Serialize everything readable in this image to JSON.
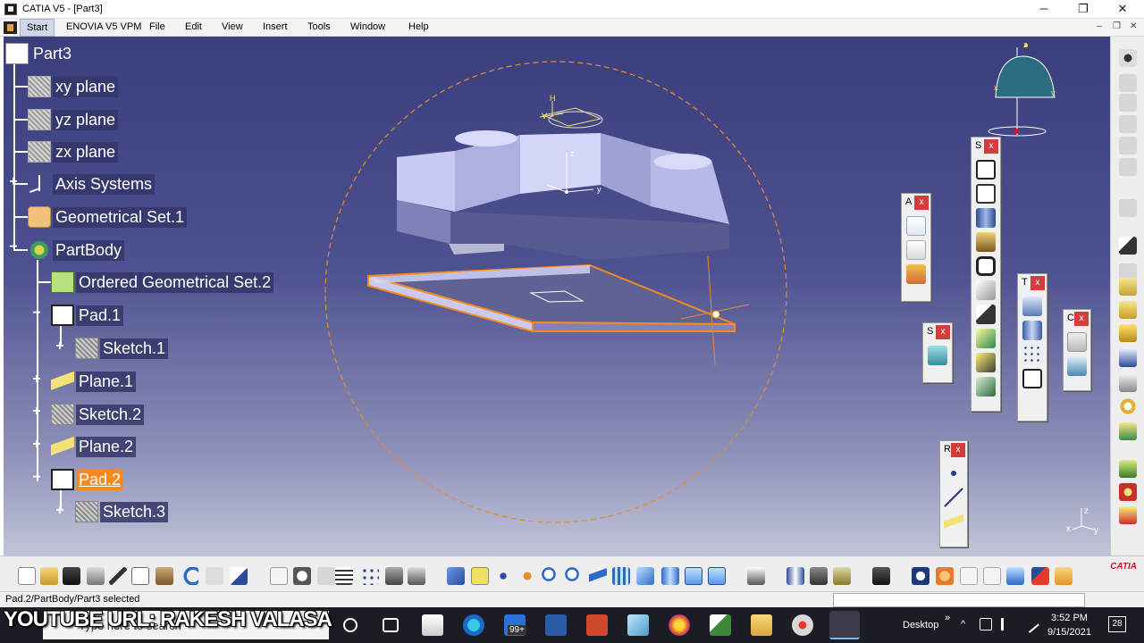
{
  "window": {
    "title": "CATIA V5 - [Part3]",
    "minimize": "─",
    "restore": "❐",
    "close": "✕"
  },
  "menu": {
    "items": [
      "Start",
      "ENOVIA V5 VPM",
      "File",
      "Edit",
      "View",
      "Insert",
      "Tools",
      "Window",
      "Help"
    ],
    "mdi_min": "–",
    "mdi_restore": "❐",
    "mdi_close": "✕"
  },
  "tree": {
    "root": "Part3",
    "nodes": [
      {
        "label": "xy plane",
        "icon": "plane-icon"
      },
      {
        "label": "yz plane",
        "icon": "plane-icon"
      },
      {
        "label": "zx plane",
        "icon": "plane-icon"
      },
      {
        "label": "Axis Systems",
        "icon": "axis-systems-icon"
      },
      {
        "label": "Geometrical Set.1",
        "icon": "geometrical-set-icon"
      },
      {
        "label": "PartBody",
        "icon": "partbody-icon"
      },
      {
        "label": "Ordered Geometrical Set.2",
        "icon": "ordered-geometrical-set-icon"
      },
      {
        "label": "Pad.1",
        "icon": "pad-icon"
      },
      {
        "label": "Sketch.1",
        "icon": "sketch-icon"
      },
      {
        "label": "Plane.1",
        "icon": "plane-feature-icon"
      },
      {
        "label": "Sketch.2",
        "icon": "sketch-icon"
      },
      {
        "label": "Plane.2",
        "icon": "plane-feature-icon"
      },
      {
        "label": "Pad.2",
        "icon": "pad-icon",
        "selected": true
      },
      {
        "label": "Sketch.3",
        "icon": "sketch-icon"
      }
    ],
    "expander_plus": "+",
    "expander_minus": "−"
  },
  "toolbars": {
    "annotations": {
      "label": "A",
      "close": "x"
    },
    "sketcher": {
      "label": "S",
      "close": "x"
    },
    "surfaces": {
      "label": "S",
      "close": "x"
    },
    "transformations": {
      "label": "T",
      "close": "x"
    },
    "constraints": {
      "label": "C",
      "close": "x"
    },
    "reference": {
      "label": "R",
      "close": "x"
    }
  },
  "compass": {
    "x": "x",
    "y": "y",
    "z": "z"
  },
  "axis_triad": {
    "x": "x",
    "y": "y",
    "z": "z"
  },
  "part_axis": {
    "y": "y",
    "z": "z"
  },
  "sketch_axis": {
    "h": "H",
    "v": "V"
  },
  "status": {
    "text": "Pad.2/PartBody/Part3 selected"
  },
  "bottom_toolbar": {
    "logo": "CATIA"
  },
  "taskbar": {
    "search_placeholder": "Type here to search",
    "overlay_text": "YOUTUBE URL: RAKESH VALASA",
    "mail_badge": "99+",
    "desktop_label": "Desktop",
    "time": "3:52 PM",
    "date": "9/15/2021",
    "notification_count": "28",
    "chevron": "»",
    "up_arrow": "^"
  },
  "colors": {
    "selection": "#f68a1f",
    "viewport_top": "#3b3e7c",
    "viewport_bottom": "#c2c4d8",
    "part_solid": "#c8caf2"
  }
}
